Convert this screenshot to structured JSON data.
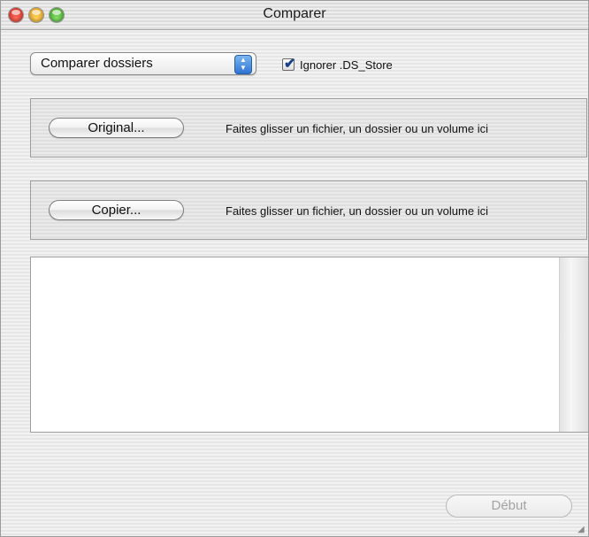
{
  "window": {
    "title": "Comparer"
  },
  "mode_popup": {
    "selected": "Comparer dossiers"
  },
  "ignore_ds_store": {
    "label": "Ignorer .DS_Store",
    "checked": true
  },
  "original": {
    "button_label": "Original...",
    "drop_hint": "Faites glisser un fichier, un dossier ou un volume ici"
  },
  "copy": {
    "button_label": "Copier...",
    "drop_hint": "Faites glisser un fichier, un dossier ou un volume ici"
  },
  "actions": {
    "start_label": "Début"
  },
  "icons": {
    "checkmark": "✔",
    "popup_arrows": "▲▼",
    "resize_grip": "◢"
  }
}
